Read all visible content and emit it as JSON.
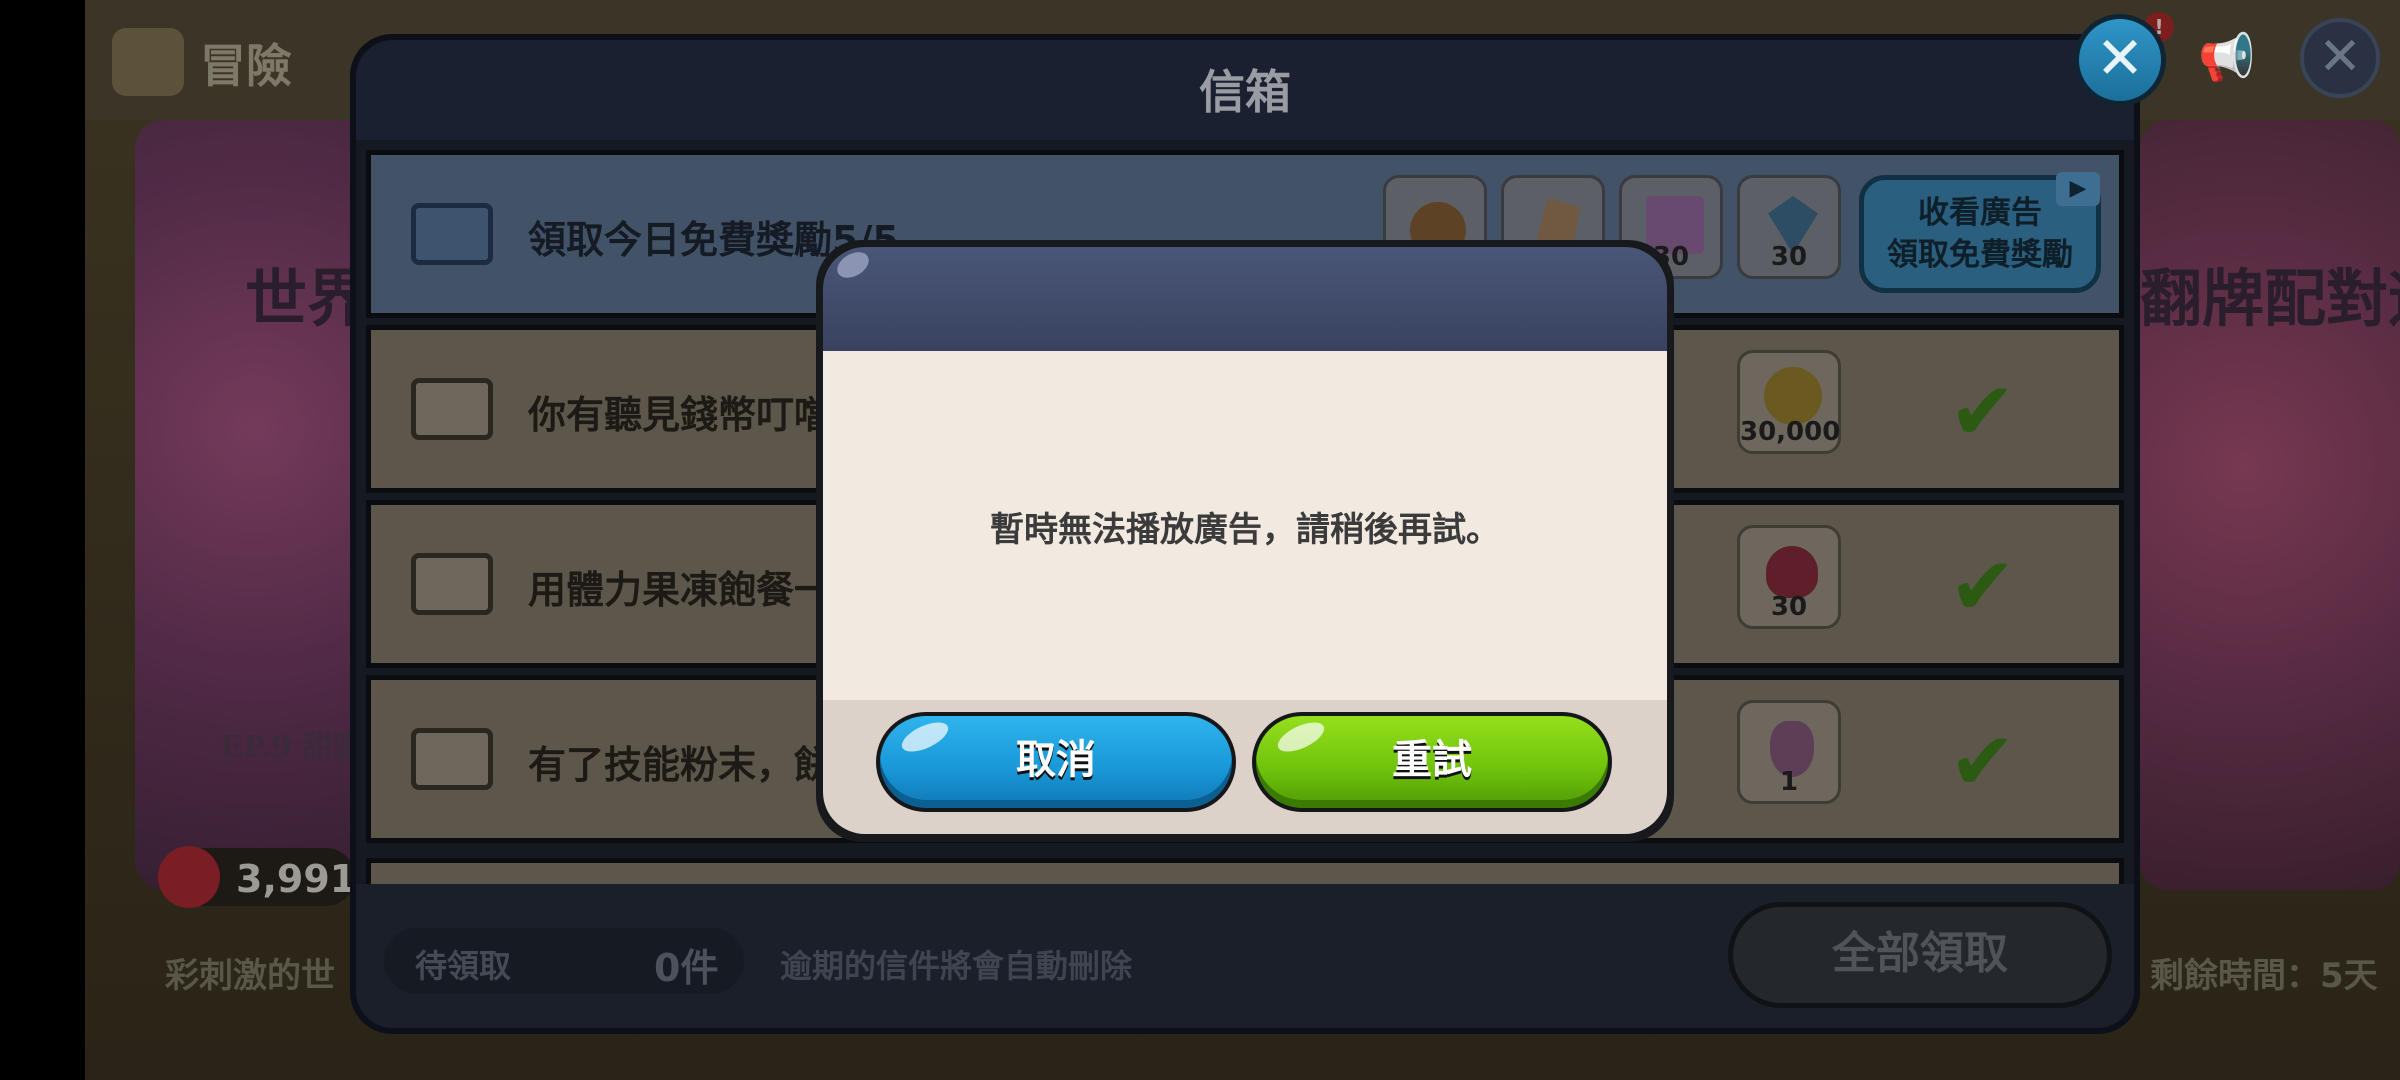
{
  "background": {
    "adventure_title": "冒險",
    "left_banner_title": "世界",
    "left_banner_episode": "EP.9 甜蜜",
    "stamina": "3,991/",
    "left_ticker": "彩刺激的世",
    "right_banner_title": "翻牌配對遊",
    "right_ticker": "剩餘時間：5天",
    "notification_badge": "!"
  },
  "mailbox": {
    "title": "信箱",
    "ad_row": {
      "text": "領取今日免費獎勵5/5",
      "rewards": [
        {
          "icon": "cookie-icon",
          "qty": ""
        },
        {
          "icon": "soulstone-icon",
          "qty": ""
        },
        {
          "icon": "cube-icon",
          "qty": "30"
        },
        {
          "icon": "crystal-icon",
          "qty": "30"
        }
      ],
      "button_line1": "收看廣告",
      "button_line2": "領取免費獎勵"
    },
    "rows": [
      {
        "text": "你有聽見錢幣叮噹",
        "reward_icon": "coin-icon",
        "reward_qty": "30,000"
      },
      {
        "text": "用體力果凍飽餐一",
        "reward_icon": "heart-jelly-icon",
        "reward_qty": "30"
      },
      {
        "text": "有了技能粉末，餅",
        "reward_icon": "skill-powder-icon",
        "reward_qty": "1"
      }
    ],
    "footer": {
      "pending_label": "待領取",
      "pending_count": "0件",
      "expire_note": "逾期的信件將會自動刪除",
      "claim_all": "全部領取"
    }
  },
  "dialog": {
    "message": "暫時無法播放廣告，請稍後再試。",
    "cancel_label": "取消",
    "retry_label": "重試"
  },
  "colors": {
    "cancel_button": "#1896d6",
    "retry_button": "#6ec10c",
    "dialog_header": "#404b6b",
    "dialog_body": "#f2e9e1"
  }
}
